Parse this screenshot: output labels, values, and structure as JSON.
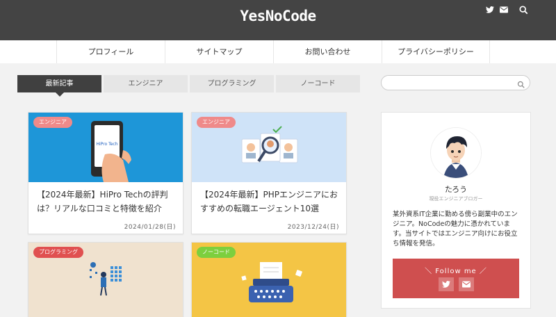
{
  "header": {
    "logo": "YesNoCode",
    "icons": [
      "twitter-icon",
      "mail-icon",
      "search-icon"
    ]
  },
  "nav": {
    "items": [
      "プロフィール",
      "サイトマップ",
      "お問い合わせ",
      "プライバシーポリシー"
    ]
  },
  "tabs": [
    {
      "label": "最新記事",
      "active": true
    },
    {
      "label": "エンジニア",
      "active": false
    },
    {
      "label": "プログラミング",
      "active": false
    },
    {
      "label": "ノーコード",
      "active": false
    }
  ],
  "search": {
    "placeholder": "",
    "value": ""
  },
  "articles": [
    {
      "category": "エンジニア",
      "category_color": "#ef8a8a",
      "title": "【2024年最新】HiPro Techの評判は？リアルな口コミと特徴を紹介",
      "date": "2024/01/28(日)",
      "thumb_bg": "#1e96d8",
      "thumb_text": "HiPro Tech"
    },
    {
      "category": "エンジニア",
      "category_color": "#ef8a8a",
      "title": "【2024年最新】PHPエンジニアにおすすめの転職エージェント10選",
      "date": "2023/12/24(日)",
      "thumb_bg": "#cfe3f8"
    },
    {
      "category": "プログラミング",
      "category_color": "#e05050",
      "title": "",
      "date": "",
      "thumb_bg": "#f0e2cf"
    },
    {
      "category": "ノーコード",
      "category_color": "#7dcf3e",
      "title": "",
      "date": "",
      "thumb_bg": "#f4c545"
    }
  ],
  "profile": {
    "name": "たろう",
    "role": "現役エンジニアブロガー",
    "description": "某外資系IT企業に勤める傍ら副業中のエンジニア。NoCodeの魅力に憑かれています。当サイトではエンジニア向けにお役立ち情報を発信。",
    "follow_label": "＼ Follow me ／",
    "follow_icons": [
      "twitter-icon",
      "mail-icon"
    ]
  },
  "colors": {
    "header_bg": "#444444",
    "follow_bg": "#cf4f4f",
    "active_tab": "#404040"
  }
}
